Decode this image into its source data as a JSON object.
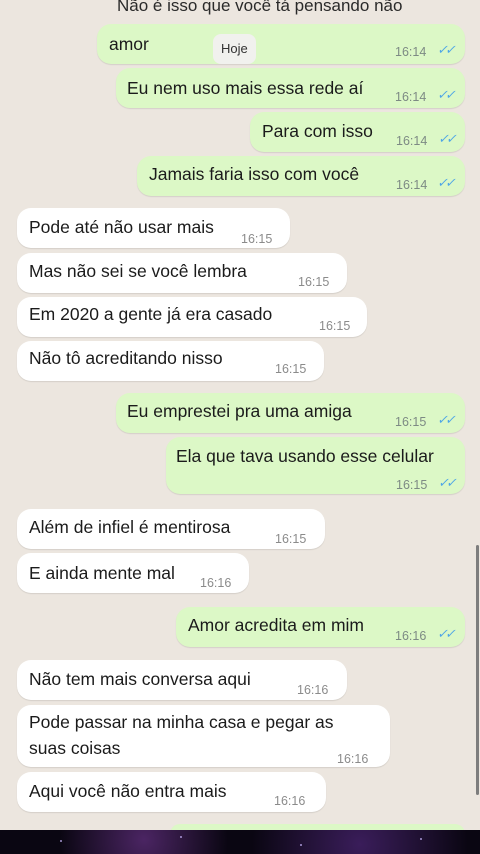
{
  "partial_top_text": "Não é isso que você tá pensando não",
  "date_chip": "Hoje",
  "read_ticks": "✓✓",
  "messages": [
    {
      "dir": "out",
      "text": "amor",
      "time": "16:14"
    },
    {
      "dir": "out",
      "text": "Eu nem uso mais essa rede aí",
      "time": "16:14"
    },
    {
      "dir": "out",
      "text": "Para com isso",
      "time": "16:14"
    },
    {
      "dir": "out",
      "text": "Jamais faria isso com você",
      "time": "16:14"
    },
    {
      "dir": "in",
      "text": "Pode até não usar mais",
      "time": "16:15"
    },
    {
      "dir": "in",
      "text": "Mas não sei se você lembra",
      "time": "16:15"
    },
    {
      "dir": "in",
      "text": "Em 2020 a gente já era casado",
      "time": "16:15"
    },
    {
      "dir": "in",
      "text": "Não tô acreditando nisso",
      "time": "16:15"
    },
    {
      "dir": "out",
      "text": "Eu emprestei pra uma amiga",
      "time": "16:15"
    },
    {
      "dir": "out",
      "text": "Ela que tava usando esse celular",
      "time": "16:15"
    },
    {
      "dir": "in",
      "text": "Além de infiel é mentirosa",
      "time": "16:15"
    },
    {
      "dir": "in",
      "text": "E ainda mente mal",
      "time": "16:16"
    },
    {
      "dir": "out",
      "text": "Amor acredita em mim",
      "time": "16:16"
    },
    {
      "dir": "in",
      "text": "Não tem mais conversa aqui",
      "time": "16:16"
    },
    {
      "dir": "in",
      "text": "Pode passar na minha casa e pegar as suas coisas",
      "time": "16:16"
    },
    {
      "dir": "in",
      "text": "Aqui você não entra mais",
      "time": "16:16"
    }
  ]
}
